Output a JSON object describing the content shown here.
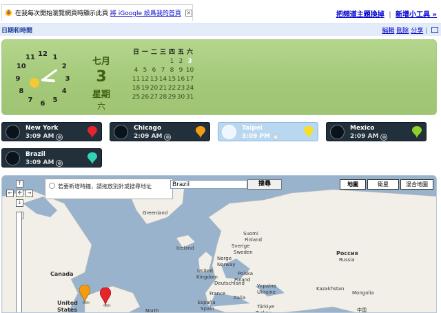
{
  "notice": {
    "text": "在我每次開始瀏覽網頁時顯示此頁",
    "link": "將 iGoogle 設爲我的首頁"
  },
  "toplinks": {
    "theme": "把頻道主題換掉",
    "new_gadget": "新增小工具 »",
    "sep": "|"
  },
  "gadget": {
    "title": "日期和時間",
    "edit": "編輯",
    "delete": "刪除",
    "share": "分享",
    "sep": "|"
  },
  "clock": {
    "numbers": [
      "12",
      "1",
      "2",
      "3",
      "4",
      "5",
      "6",
      "7",
      "8",
      "9",
      "10",
      "11"
    ],
    "hour": 3,
    "minute": 9
  },
  "date": {
    "month": "七月",
    "day": "3",
    "week_label": "星期",
    "weekday": "六"
  },
  "calendar": {
    "headers": [
      "日",
      "一",
      "二",
      "三",
      "四",
      "五",
      "六"
    ],
    "weeks": [
      [
        "",
        "",
        "",
        "",
        "",
        "",
        "3"
      ],
      [
        "4",
        "5",
        "6",
        "7",
        "8",
        "9",
        "10"
      ],
      [
        "11",
        "12",
        "13",
        "14",
        "15",
        "16",
        "17"
      ],
      [
        "18",
        "19",
        "20",
        "21",
        "22",
        "23",
        "24"
      ],
      [
        "25",
        "26",
        "27",
        "28",
        "29",
        "30",
        "31"
      ]
    ],
    "first_row": [
      "",
      "",
      "",
      "",
      "1",
      "2",
      "3"
    ],
    "today": "3"
  },
  "cities": [
    {
      "name": "New York",
      "time": "3:09 AM",
      "pin_color": "#e8232b",
      "daytime": false
    },
    {
      "name": "Chicago",
      "time": "2:09 AM",
      "pin_color": "#f39c12",
      "daytime": false
    },
    {
      "name": "Taipei",
      "time": "3:09 PM",
      "pin_color": "#f4e02a",
      "daytime": true
    },
    {
      "name": "Mexico",
      "time": "2:09 AM",
      "pin_color": "#8fd12b",
      "daytime": false
    },
    {
      "name": "Brazil",
      "time": "3:09 AM",
      "pin_color": "#30d6b3",
      "daytime": false
    }
  ],
  "remove_glyph": "⊗",
  "map": {
    "hint": "若要新增時鐘，請拖放別針或搜尋地址",
    "search_value": "Brazil",
    "search_button": "搜尋",
    "types": [
      "地圖",
      "衛星",
      "混合地圖"
    ],
    "selected_type": "地圖",
    "labels": [
      {
        "text": "Greenland",
        "big": false
      },
      {
        "text": "Iceland",
        "big": false
      },
      {
        "text": "Suomi",
        "big": false
      },
      {
        "text": "Finland",
        "big": false
      },
      {
        "text": "Sverige",
        "big": false
      },
      {
        "text": "Sweden",
        "big": false
      },
      {
        "text": "Norge",
        "big": false
      },
      {
        "text": "Norway",
        "big": false
      },
      {
        "text": "United",
        "big": false
      },
      {
        "text": "Kingdom",
        "big": false
      },
      {
        "text": "Deutschland",
        "big": false
      },
      {
        "text": "Polska",
        "big": false
      },
      {
        "text": "Poland",
        "big": false
      },
      {
        "text": "Украіна",
        "big": false
      },
      {
        "text": "Ukraine",
        "big": false
      },
      {
        "text": "France",
        "big": false
      },
      {
        "text": "Italia",
        "big": false
      },
      {
        "text": "España",
        "big": false
      },
      {
        "text": "Spain",
        "big": false
      },
      {
        "text": "Türkiye",
        "big": false
      },
      {
        "text": "Turkey",
        "big": false
      },
      {
        "text": "Kazakhstan",
        "big": false
      },
      {
        "text": "Россия",
        "big": true
      },
      {
        "text": "Russia",
        "big": false
      },
      {
        "text": "Mongolia",
        "big": false
      },
      {
        "text": "中国",
        "big": false
      },
      {
        "text": "Canada",
        "big": true
      },
      {
        "text": "United",
        "big": true
      },
      {
        "text": "States",
        "big": true
      },
      {
        "text": "North",
        "big": false
      }
    ],
    "nav_buttons": [
      "↑",
      "←",
      "✣",
      "→",
      "↓",
      "+"
    ]
  },
  "colors": {
    "panel_green": "#a2c878",
    "link_blue": "#0000cc",
    "title_bar": "#e5ecf9"
  }
}
